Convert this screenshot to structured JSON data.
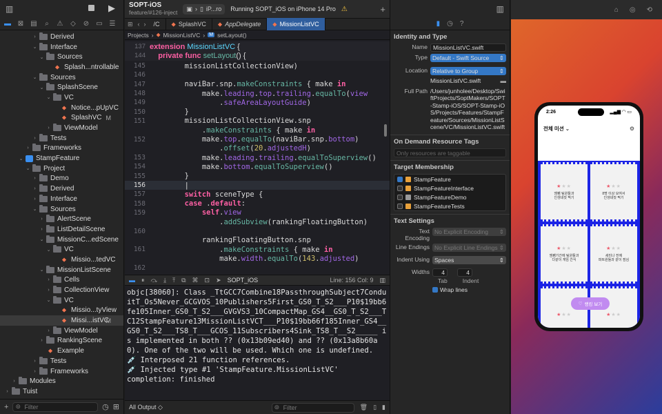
{
  "toolbar": {
    "scheme_name": "SOPT-iOS",
    "branch": "feature/#126-inject",
    "device": "iP...ro",
    "status": "Running SOPT_iOS on iPhone 14 Pro"
  },
  "tabs": [
    {
      "label": "/C"
    },
    {
      "label": "SplashVC"
    },
    {
      "label": "AppDelegate"
    },
    {
      "label": "MissionListVC"
    }
  ],
  "breadcrumb": {
    "root": "Projects",
    "file": "MissionListVC",
    "symbol": "setLayout()"
  },
  "navigator": {
    "filter_placeholder": "Filter",
    "items": [
      {
        "label": "Derived",
        "indent": 4,
        "kind": "folder",
        "chev": "›"
      },
      {
        "label": "Interface",
        "indent": 4,
        "kind": "folder",
        "chev": "⌄"
      },
      {
        "label": "Sources",
        "indent": 5,
        "kind": "folder",
        "chev": "⌄"
      },
      {
        "label": "Splash...ntrollable",
        "indent": 6,
        "kind": "swift",
        "chev": ""
      },
      {
        "label": "Sources",
        "indent": 4,
        "kind": "folder",
        "chev": "⌄"
      },
      {
        "label": "SplashScene",
        "indent": 5,
        "kind": "folder",
        "chev": "⌄"
      },
      {
        "label": "VC",
        "indent": 6,
        "kind": "folder",
        "chev": "⌄"
      },
      {
        "label": "Notice...pUpVC",
        "indent": 7,
        "kind": "swift",
        "chev": ""
      },
      {
        "label": "SplashVC",
        "indent": 7,
        "kind": "swift",
        "chev": "",
        "badge": "M"
      },
      {
        "label": "ViewModel",
        "indent": 6,
        "kind": "folder",
        "chev": "›"
      },
      {
        "label": "Tests",
        "indent": 4,
        "kind": "folder",
        "chev": "›"
      },
      {
        "label": "Frameworks",
        "indent": 3,
        "kind": "folder",
        "chev": "›"
      },
      {
        "label": "StampFeature",
        "indent": 2,
        "kind": "pkg",
        "chev": "⌄"
      },
      {
        "label": "Project",
        "indent": 3,
        "kind": "folder",
        "chev": "⌄"
      },
      {
        "label": "Demo",
        "indent": 4,
        "kind": "folder",
        "chev": "›"
      },
      {
        "label": "Derived",
        "indent": 4,
        "kind": "folder",
        "chev": "›"
      },
      {
        "label": "Interface",
        "indent": 4,
        "kind": "folder",
        "chev": "›"
      },
      {
        "label": "Sources",
        "indent": 4,
        "kind": "folder",
        "chev": "⌄"
      },
      {
        "label": "AlertScene",
        "indent": 5,
        "kind": "folder",
        "chev": "›"
      },
      {
        "label": "ListDetailScene",
        "indent": 5,
        "kind": "folder",
        "chev": "›"
      },
      {
        "label": "MissionC...edScene",
        "indent": 5,
        "kind": "folder",
        "chev": "⌄"
      },
      {
        "label": "VC",
        "indent": 6,
        "kind": "folder",
        "chev": "⌄"
      },
      {
        "label": "Missio...tedVC",
        "indent": 7,
        "kind": "swift",
        "chev": ""
      },
      {
        "label": "MissionListScene",
        "indent": 5,
        "kind": "folder",
        "chev": "⌄"
      },
      {
        "label": "Cells",
        "indent": 6,
        "kind": "folder",
        "chev": "›"
      },
      {
        "label": "CollectionView",
        "indent": 6,
        "kind": "folder",
        "chev": "›"
      },
      {
        "label": "VC",
        "indent": 6,
        "kind": "folder",
        "chev": "⌄"
      },
      {
        "label": "Missio...tyView",
        "indent": 7,
        "kind": "swift",
        "chev": ""
      },
      {
        "label": "Missi...istVC",
        "indent": 7,
        "kind": "swift",
        "chev": "",
        "badge": "M",
        "selected": true
      },
      {
        "label": "ViewModel",
        "indent": 6,
        "kind": "folder",
        "chev": "›"
      },
      {
        "label": "RankingScene",
        "indent": 5,
        "kind": "folder",
        "chev": "›"
      },
      {
        "label": "Example",
        "indent": 5,
        "kind": "swift",
        "chev": ""
      },
      {
        "label": "Tests",
        "indent": 4,
        "kind": "folder",
        "chev": "›"
      },
      {
        "label": "Frameworks",
        "indent": 4,
        "kind": "folder",
        "chev": "›"
      },
      {
        "label": "Modules",
        "indent": 1,
        "kind": "folder",
        "chev": "›"
      },
      {
        "label": "Tuist",
        "indent": 0,
        "kind": "folder",
        "chev": "›"
      }
    ]
  },
  "code_sticky": [
    {
      "ln": "137",
      "html": "<span class='kw'>extension</span> <span class='ty'>MissionListVC</span> {"
    },
    {
      "ln": "144",
      "html": "    <span class='kw'>private func</span> <span class='fn'>setLayout</span>() {"
    }
  ],
  "code": [
    {
      "ln": "145",
      "html": "        missionListCollectionView)"
    },
    {
      "ln": "146",
      "html": ""
    },
    {
      "ln": "147",
      "html": "        naviBar.snp.<span class='fn'>makeConstraints</span> { make <span class='kw'>in</span>"
    },
    {
      "ln": "148",
      "html": "            make.<span class='pr'>leading</span>.<span class='pr'>top</span>.<span class='pr'>trailing</span>.<span class='fn'>equalTo</span>(<span class='pr'>view</span>"
    },
    {
      "ln": "149",
      "html": "                .<span class='pr'>safeAreaLayoutGuide</span>)"
    },
    {
      "ln": "150",
      "html": "        }"
    },
    {
      "ln": "151",
      "html": "        missionListCollectionView.snp"
    },
    {
      "ln": "",
      "html": "            .<span class='fn'>makeConstraints</span> { make <span class='kw'>in</span>"
    },
    {
      "ln": "152",
      "html": "            make.<span class='pr'>top</span>.<span class='fn'>equalTo</span>(naviBar.snp.<span class='pr'>bottom</span>)"
    },
    {
      "ln": "",
      "html": "                .<span class='fn'>offset</span>(<span class='num'>20</span>.<span class='pr'>adjustedH</span>)"
    },
    {
      "ln": "153",
      "html": "            make.<span class='pr'>leading</span>.<span class='pr'>trailing</span>.<span class='fn'>equalToSuperview</span>()"
    },
    {
      "ln": "154",
      "html": "            make.<span class='pr'>bottom</span>.<span class='fn'>equalToSuperview</span>()"
    },
    {
      "ln": "155",
      "html": "        }"
    },
    {
      "ln": "156",
      "html": "        |",
      "current": true
    },
    {
      "ln": "157",
      "html": "        <span class='kw'>switch</span> sceneType {"
    },
    {
      "ln": "158",
      "html": "        <span class='kw'>case</span> .<span class='kw'>default</span>:"
    },
    {
      "ln": "159",
      "html": "            <span class='kw'>self</span>.<span class='pr'>view</span>"
    },
    {
      "ln": "",
      "html": "                .<span class='fn'>addSubview</span>(rankingFloatingButton)"
    },
    {
      "ln": "160",
      "html": ""
    },
    {
      "ln": "",
      "html": "            rankingFloatingButton.snp"
    },
    {
      "ln": "161",
      "html": "                .<span class='fn'>makeConstraints</span> { make <span class='kw'>in</span>"
    },
    {
      "ln": "",
      "html": "                make.<span class='pr'>width</span>.<span class='fn'>equalTo</span>(<span class='num'>143</span>.<span class='pr'>adjusted</span>)"
    },
    {
      "ln": "162",
      "html": ""
    }
  ],
  "debug": {
    "target": "SOPT_iOS",
    "position": "Line: 156  Col: 9",
    "output_label": "All Output ◇",
    "filter_placeholder": "Filter"
  },
  "console_text": "objc[38060]: Class _TtGCC7Combine18PassthroughSubject7ConduitT_Os5Never_GCGVOS_10Publishers5First_GS0_T_S2___P10$19bb6fe105Inner_GS0_T_S2___GVGVS3_10CompactMap_GS4__GS0_T_S2___TC12StampFeature13MissionListVCT___P10$19bb66f185Inner_GS4__GS0_T_S2___TS8_T___GCOS_11Subscribers4Sink_TS8_T__S2_____ is implemented in both ?? (0x13b09ed40) and ?? (0x13a8b60a0). One of the two will be used. Which one is undefined.\n💉 Interposed 21 function references.\n💉 Injected type #1 'StampFeature.MissionListVC'\ncompletion: finished",
  "inspector": {
    "identity_title": "Identity and Type",
    "name_label": "Name",
    "name_value": "MissionListVC.swift",
    "type_label": "Type",
    "type_value": "Default - Swift Source",
    "location_label": "Location",
    "location_value": "Relative to Group",
    "location_file": "MissionListVC.swift",
    "fullpath_label": "Full Path",
    "fullpath_value": "/Users/junholee/Desktop/SwiftProjects/SoptMakers/SOPT-Stamp-iOS/SOPT-Stamp-iOS/Projects/Features/StampFeature/Sources/MissionListScene/VC/MissionListVC.swift",
    "odr_title": "On Demand Resource Tags",
    "odr_placeholder": "Only resources are taggable",
    "membership_title": "Target Membership",
    "targets": [
      {
        "label": "StampFeature",
        "checked": true,
        "icon": "orange"
      },
      {
        "label": "StampFeatureInterface",
        "checked": false,
        "icon": "orange"
      },
      {
        "label": "StampFeatureDemo",
        "checked": false,
        "icon": "gray"
      },
      {
        "label": "StampFeatureTests",
        "checked": false,
        "icon": "orange"
      }
    ],
    "text_title": "Text Settings",
    "encoding_label": "Text Encoding",
    "encoding_value": "No Explicit Encoding",
    "endings_label": "Line Endings",
    "endings_value": "No Explicit Line Endings",
    "indent_label": "Indent Using",
    "indent_value": "Spaces",
    "widths_label": "Widths",
    "tab_width": "4",
    "indent_width": "4",
    "tab_label": "Tab",
    "indent_sub_label": "Indent",
    "wrap_label": "Wrap lines"
  },
  "phone": {
    "time": "2:26",
    "menu_title": "전체 미션 ⌄",
    "fab_label": "랭킹 보기",
    "cards": [
      {
        "stars": 1,
        "title": "엠팸 팀원들과\n인생네컷 찍기"
      },
      {
        "stars": 1,
        "title": "8명 이상 모여서\n인생네컷 찍기"
      },
      {
        "stars": 1,
        "title": "엠팸기간에 팀원들과\n다같이 게임 간식"
      },
      {
        "stars": 1,
        "title": "세미나 전에\n파트원들과 같이 점심"
      },
      {
        "stars": 1,
        "title": ""
      },
      {
        "stars": 1,
        "title": ""
      }
    ]
  }
}
